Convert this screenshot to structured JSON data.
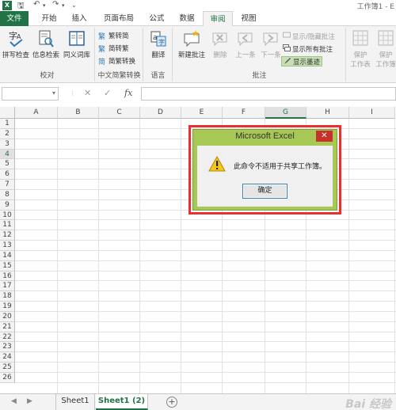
{
  "title_bar": {
    "app_icon_letter": "X",
    "doc_title": "工作簿1 - E"
  },
  "tabs": [
    {
      "label": "文件",
      "state": "file"
    },
    {
      "label": "开始",
      "state": "normal"
    },
    {
      "label": "插入",
      "state": "normal"
    },
    {
      "label": "页面布局",
      "state": "normal"
    },
    {
      "label": "公式",
      "state": "normal"
    },
    {
      "label": "数据",
      "state": "normal"
    },
    {
      "label": "审阅",
      "state": "active"
    },
    {
      "label": "视图",
      "state": "normal"
    }
  ],
  "ribbon": {
    "proofing": {
      "group_label": "校对",
      "spell_check": "拼写检查",
      "research": "信息检索",
      "thesaurus": "同义词库"
    },
    "chinese_conversion": {
      "group_label": "中文简繁转换",
      "to_traditional": "繁转简",
      "to_simplified": "简转繁",
      "convert": "简繁转换"
    },
    "language": {
      "group_label": "语言",
      "translate": "翻译"
    },
    "comments": {
      "group_label": "批注",
      "new_comment": "新建批注",
      "delete": "删除",
      "previous": "上一条",
      "next": "下一条",
      "show_hide": "显示/隐藏批注",
      "show_all": "显示所有批注",
      "show_ink": "显示墨迹"
    },
    "changes": {
      "protect_sheet_1": "保护",
      "protect_sheet_2": "工作表",
      "protect_workbook_1": "保护",
      "protect_workbook_2": "工作簿"
    }
  },
  "formula_bar": {
    "name_box_value": "",
    "cancel_glyph": "✕",
    "enter_glyph": "✓",
    "fx_label": "fx",
    "formula_value": ""
  },
  "grid": {
    "columns": [
      "A",
      "B",
      "C",
      "D",
      "E",
      "F",
      "G",
      "H",
      "I"
    ],
    "selected_column": "G",
    "rows": [
      "1",
      "2",
      "3",
      "4",
      "5",
      "6",
      "7",
      "8",
      "9",
      "10",
      "11",
      "12",
      "13",
      "14",
      "15",
      "16",
      "17",
      "18",
      "19",
      "20",
      "21",
      "22",
      "23",
      "24",
      "25",
      "26"
    ],
    "selected_row": "4"
  },
  "sheet_tabs": {
    "sheets": [
      {
        "name": "Sheet1",
        "active": false
      },
      {
        "name": "Sheet1 (2)",
        "active": true
      }
    ],
    "add_glyph": "+",
    "watermark": "Bai 经验"
  },
  "dialog": {
    "title": "Microsoft Excel",
    "close_glyph": "✕",
    "message": "此命令不适用于共享工作簿。",
    "ok_label": "确定",
    "title_color": "#a8c855",
    "highlight_color": "#e8312f"
  },
  "colors": {
    "excel_green": "#217346",
    "ribbon_bg": "#f3f3f3"
  }
}
